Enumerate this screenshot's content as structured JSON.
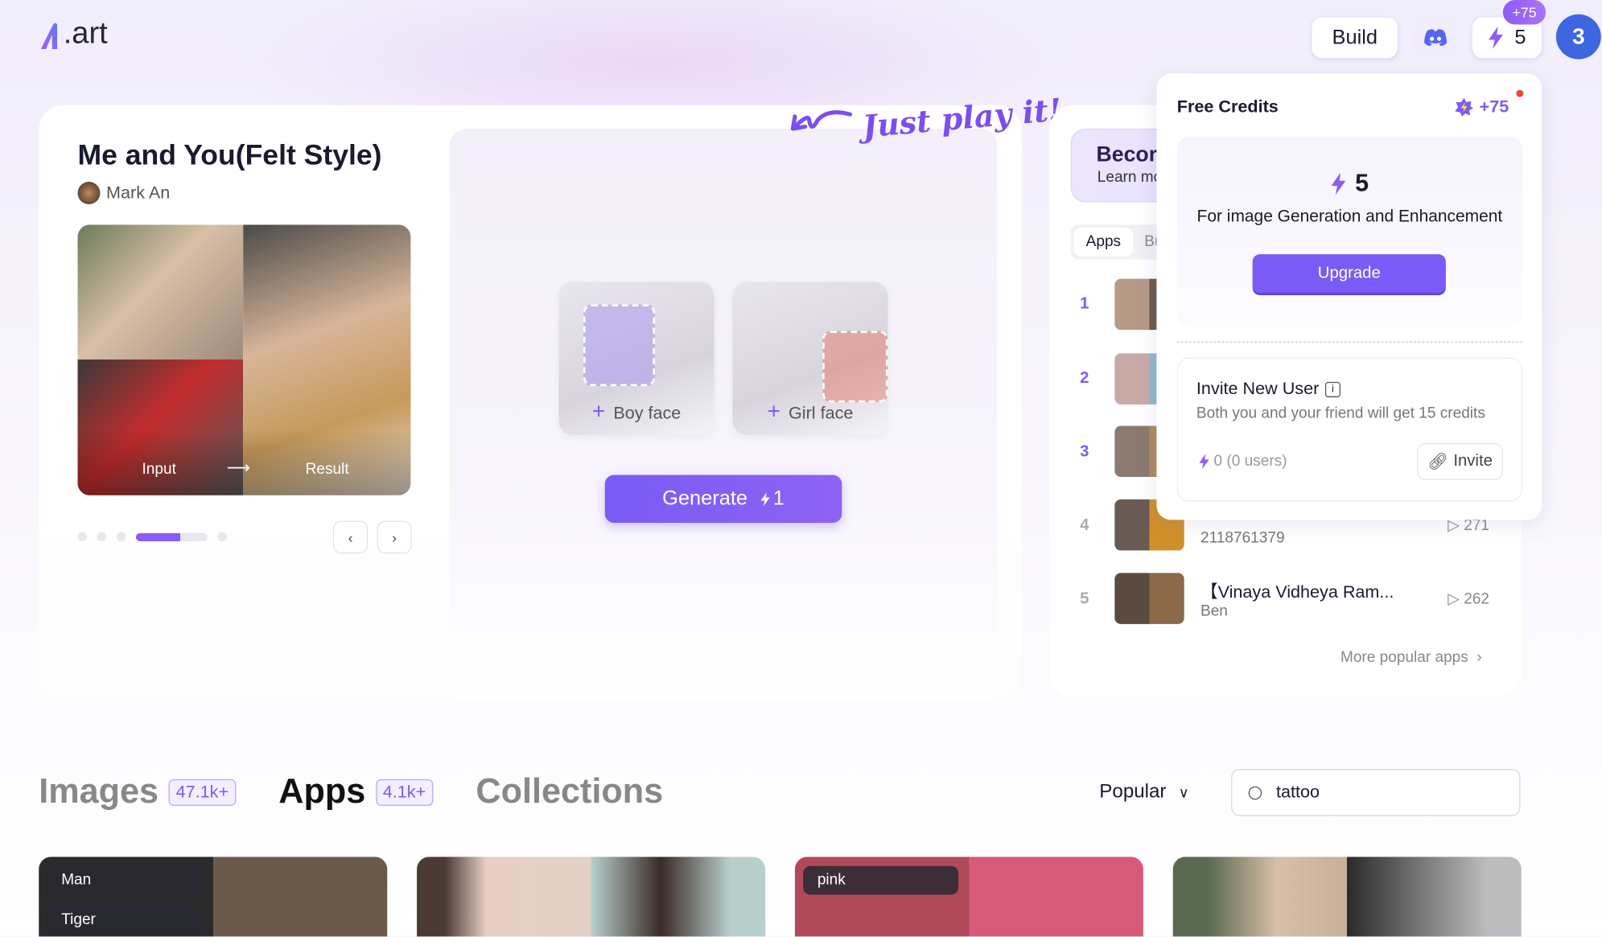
{
  "header": {
    "logo_text": ".art",
    "build_label": "Build",
    "discord_icon": "discord-icon",
    "credits": "5",
    "credits_bonus": "+75",
    "avatar_number": "3",
    "accent": "#7b5cf5"
  },
  "app_card": {
    "title": "Me and You(Felt Style)",
    "author": "Mark An",
    "input_label": "Input",
    "result_label": "Result",
    "slide_count": 6,
    "active_slide": 4,
    "boy_face_label": "Boy face",
    "girl_face_label": "Girl face",
    "generate_label": "Generate",
    "generate_cost": "1",
    "just_play": "Just play it!"
  },
  "side_panel": {
    "banner_title": "Becor",
    "banner_sub": "Learn mo",
    "tabs": [
      "Apps",
      "Bu"
    ],
    "items": [
      {
        "rank": "1"
      },
      {
        "rank": "2"
      },
      {
        "rank": "3"
      },
      {
        "rank": "4",
        "subtitle": "2118761379",
        "plays": "271"
      },
      {
        "rank": "5",
        "title": "【Vinaya Vidheya Ram...",
        "subtitle": "Ben",
        "plays": "262"
      }
    ],
    "more_label": "More popular apps"
  },
  "credits_popup": {
    "title": "Free Credits",
    "bonus": "+75",
    "amount": "5",
    "description": "For image Generation and Enhancement",
    "upgrade_label": "Upgrade",
    "invite_title": "Invite New User",
    "invite_desc": "Both you and your friend will get 15 credits",
    "invite_stats": "0 (0 users)",
    "invite_label": "Invite"
  },
  "gallery": {
    "tabs": [
      {
        "label": "Images",
        "count": "47.1k+"
      },
      {
        "label": "Apps",
        "count": "4.1k+",
        "active": true
      },
      {
        "label": "Collections"
      }
    ],
    "sort_label": "Popular",
    "search_value": "tattoo",
    "card_tags": [
      [
        "Man",
        "Tiger"
      ],
      [],
      [
        "pink"
      ],
      []
    ]
  }
}
